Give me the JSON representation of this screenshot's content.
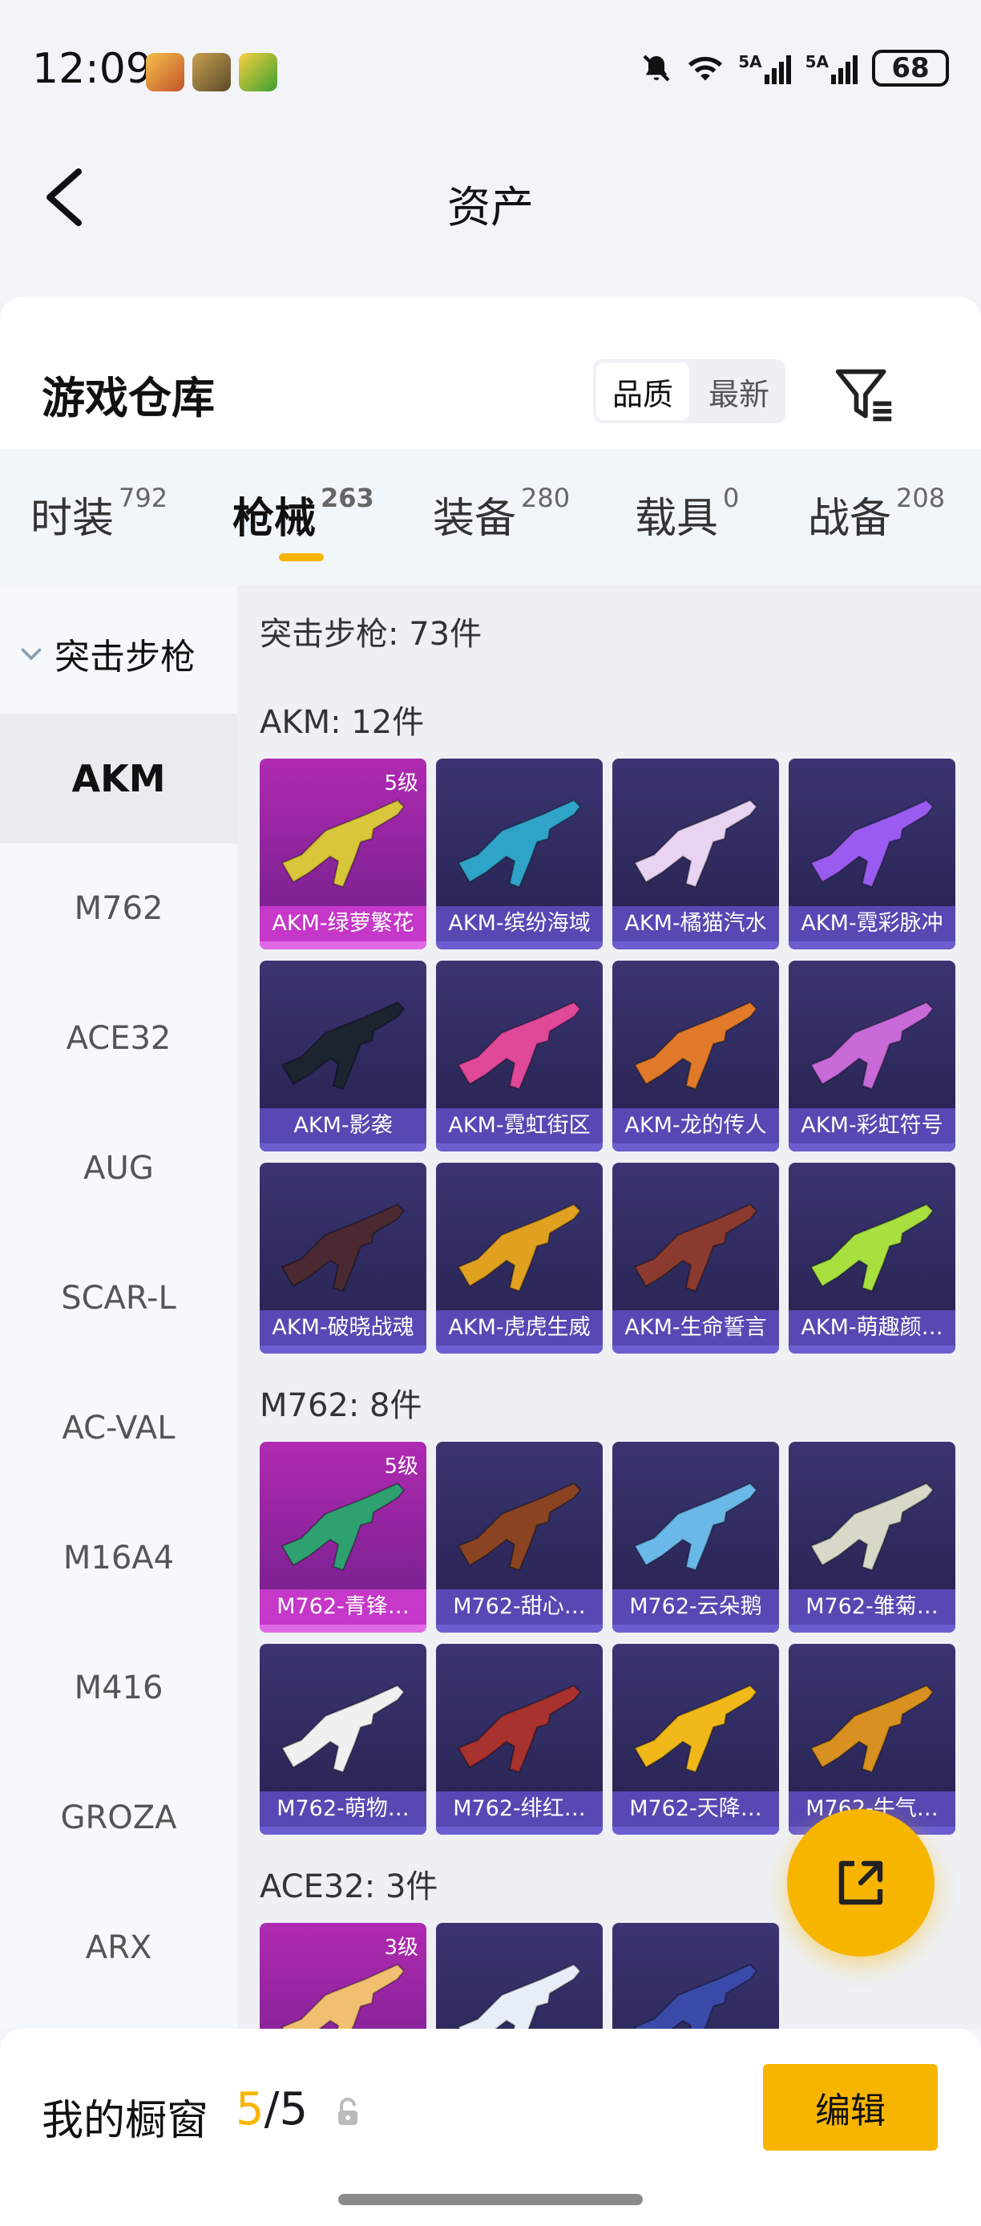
{
  "status_bar": {
    "time": "12:09",
    "battery": "68",
    "sig1": "5A",
    "sig2": "5A"
  },
  "header": {
    "title": "资产"
  },
  "warehouse": {
    "title": "游戏仓库",
    "sort_quality": "品质",
    "sort_newest": "最新"
  },
  "tabs": [
    {
      "label": "时装",
      "count": "792"
    },
    {
      "label": "枪械",
      "count": "263"
    },
    {
      "label": "装备",
      "count": "280"
    },
    {
      "label": "载具",
      "count": "0"
    },
    {
      "label": "战备",
      "count": "208"
    }
  ],
  "sidebar": {
    "category": "突击步枪",
    "items": [
      "AKM",
      "M762",
      "ACE32",
      "AUG",
      "SCAR-L",
      "AC-VAL",
      "M16A4",
      "M416",
      "GROZA",
      "ARX"
    ]
  },
  "content": {
    "summary": "突击步枪: 73件",
    "sections": [
      {
        "title": "AKM: 12件",
        "items": [
          {
            "name": "AKM-绿萝繁花",
            "level": "5级",
            "gun_color": "#d9c63a"
          },
          {
            "name": "AKM-缤纷海域",
            "level": "",
            "gun_color": "#2fa4c8"
          },
          {
            "name": "AKM-橘猫汽水",
            "level": "",
            "gun_color": "#e8d4f2"
          },
          {
            "name": "AKM-霓彩脉冲",
            "level": "",
            "gun_color": "#9a5cf0"
          },
          {
            "name": "AKM-影袭",
            "level": "",
            "gun_color": "#1c2430"
          },
          {
            "name": "AKM-霓虹街区",
            "level": "",
            "gun_color": "#e0489a"
          },
          {
            "name": "AKM-龙的传人",
            "level": "",
            "gun_color": "#e07a2a"
          },
          {
            "name": "AKM-彩虹符号",
            "level": "",
            "gun_color": "#c86ad8"
          },
          {
            "name": "AKM-破晓战魂",
            "level": "",
            "gun_color": "#4a2a30"
          },
          {
            "name": "AKM-虎虎生威",
            "level": "",
            "gun_color": "#e0a020"
          },
          {
            "name": "AKM-生命誓言",
            "level": "",
            "gun_color": "#8a3a2e"
          },
          {
            "name": "AKM-萌趣颜…",
            "level": "",
            "gun_color": "#a8e040"
          }
        ]
      },
      {
        "title": "M762: 8件",
        "items": [
          {
            "name": "M762-青锋…",
            "level": "5级",
            "gun_color": "#2fa070"
          },
          {
            "name": "M762-甜心…",
            "level": "",
            "gun_color": "#8a4422"
          },
          {
            "name": "M762-云朵鹅",
            "level": "",
            "gun_color": "#6ab8e8"
          },
          {
            "name": "M762-雏菊…",
            "level": "",
            "gun_color": "#d8d8c8"
          },
          {
            "name": "M762-萌物…",
            "level": "",
            "gun_color": "#f0f0f0"
          },
          {
            "name": "M762-绯红…",
            "level": "",
            "gun_color": "#a8322e"
          },
          {
            "name": "M762-天降…",
            "level": "",
            "gun_color": "#f0b818"
          },
          {
            "name": "M762-牛气…",
            "level": "",
            "gun_color": "#d89020"
          }
        ]
      },
      {
        "title": "ACE32: 3件",
        "items": [
          {
            "name": "",
            "level": "3级",
            "gun_color": "#f0c070"
          },
          {
            "name": "",
            "level": "",
            "gun_color": "#e8eef8"
          },
          {
            "name": "",
            "level": "",
            "gun_color": "#3a4aa8"
          }
        ]
      }
    ]
  },
  "bottom": {
    "title": "我的橱窗",
    "current": "5",
    "total": "/5",
    "edit_label": "编辑"
  },
  "colors": {
    "accent": "#f7b500",
    "card_purple": "#2e2a5e",
    "card_highlight": "#a22aa8"
  }
}
